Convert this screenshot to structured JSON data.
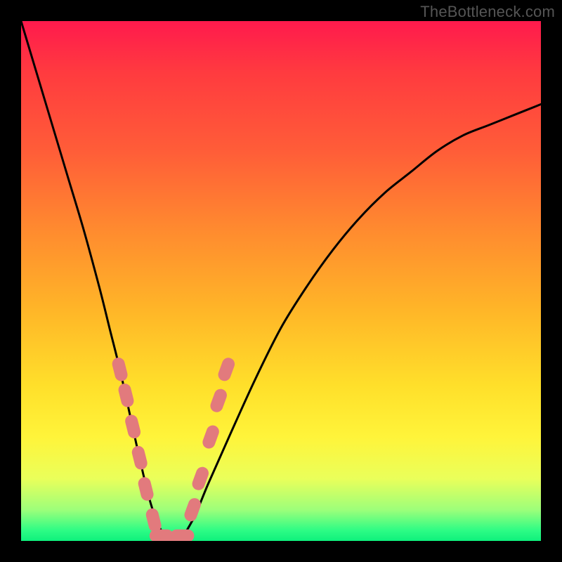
{
  "watermark": "TheBottleneck.com",
  "colors": {
    "curve": "#000000",
    "marker": "#e27a7d",
    "frame": "#000000"
  },
  "chart_data": {
    "type": "line",
    "title": "",
    "xlabel": "",
    "ylabel": "",
    "ylim": [
      0,
      100
    ],
    "xlim": [
      0,
      100
    ],
    "series": [
      {
        "name": "bottleneck-curve",
        "x": [
          0,
          3,
          6,
          9,
          12,
          15,
          17,
          19,
          21,
          23,
          25,
          27,
          30,
          33,
          36,
          40,
          45,
          50,
          55,
          60,
          65,
          70,
          75,
          80,
          85,
          90,
          95,
          100
        ],
        "values": [
          100,
          90,
          80,
          70,
          60,
          49,
          41,
          33,
          24,
          15,
          7,
          2,
          0,
          4,
          11,
          20,
          31,
          41,
          49,
          56,
          62,
          67,
          71,
          75,
          78,
          80,
          82,
          84
        ]
      }
    ],
    "markers": [
      {
        "x": 19.0,
        "y": 33
      },
      {
        "x": 20.2,
        "y": 28
      },
      {
        "x": 21.5,
        "y": 22
      },
      {
        "x": 22.8,
        "y": 16
      },
      {
        "x": 24.0,
        "y": 10
      },
      {
        "x": 25.5,
        "y": 4
      },
      {
        "x": 27.0,
        "y": 1
      },
      {
        "x": 29.0,
        "y": 0
      },
      {
        "x": 31.0,
        "y": 1
      },
      {
        "x": 33.0,
        "y": 6
      },
      {
        "x": 34.5,
        "y": 12
      },
      {
        "x": 36.5,
        "y": 20
      },
      {
        "x": 38.0,
        "y": 27
      },
      {
        "x": 39.5,
        "y": 33
      }
    ]
  }
}
